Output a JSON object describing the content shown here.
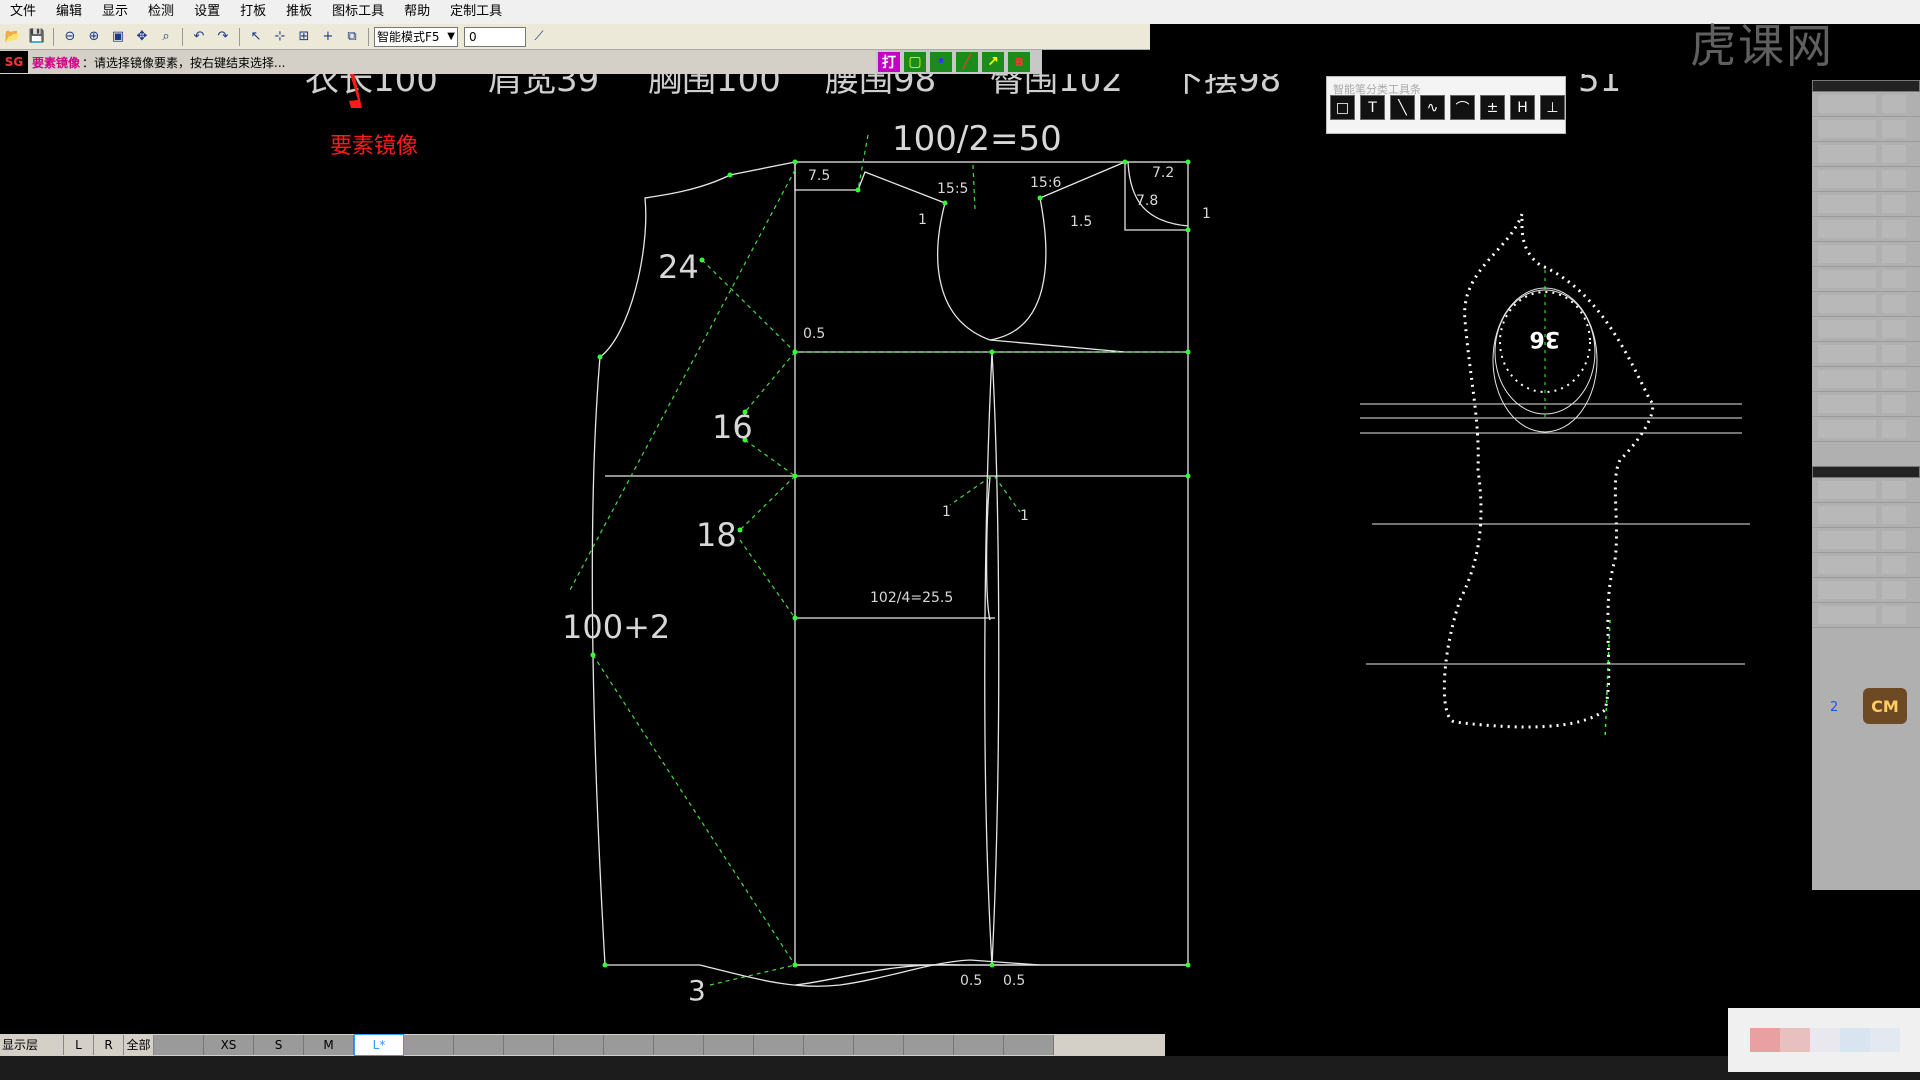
{
  "menu": [
    "文件",
    "编辑",
    "显示",
    "检测",
    "设置",
    "打板",
    "推板",
    "图标工具",
    "帮助",
    "定制工具"
  ],
  "toolbar": {
    "mode_value": "智能模式F5",
    "number_value": "0"
  },
  "status": {
    "tag": "SG",
    "command": "要素镜像",
    "message": "：请选择镜像要素，按右键结束选择..."
  },
  "float_toolbar": {
    "first": "打"
  },
  "annotation": "要素镜像",
  "measurements_header": [
    "衣长100",
    "肩宽39",
    "胸围100",
    "腰围98",
    "臀围102",
    "下摆98",
    "51"
  ],
  "pattern": {
    "half_chest": "100/2=50",
    "quarter_waist": "102/4=25.5",
    "chest_side": "100+2",
    "labels": [
      "24",
      "16",
      "18",
      "3",
      "7.5",
      "15:5",
      "15:6",
      "7.2",
      "7.8",
      "0.5",
      "1.5",
      "1",
      "1",
      "1",
      "1",
      "0.5",
      "0.5"
    ]
  },
  "dress_form_label": "36",
  "pen_toolbar": {
    "title": "智能笔分类工具条",
    "buttons": [
      "□",
      "T",
      "╲",
      "∿",
      "⌒",
      "±",
      "H",
      "⊥"
    ]
  },
  "right_panel": {
    "number": "2",
    "cm_label": "CM"
  },
  "layer_bar": {
    "label": "显示层",
    "buttons": [
      "L",
      "R",
      "全部"
    ],
    "sizes": [
      "XS",
      "S",
      "M",
      "L*"
    ],
    "active_size": "L*"
  },
  "watermark": "虎课网",
  "colors": {
    "canvas": "#000000",
    "line": "#e6e6e6",
    "point": "#33ff33",
    "dashed": "#44dd44",
    "accent": "#ff1a1a"
  }
}
